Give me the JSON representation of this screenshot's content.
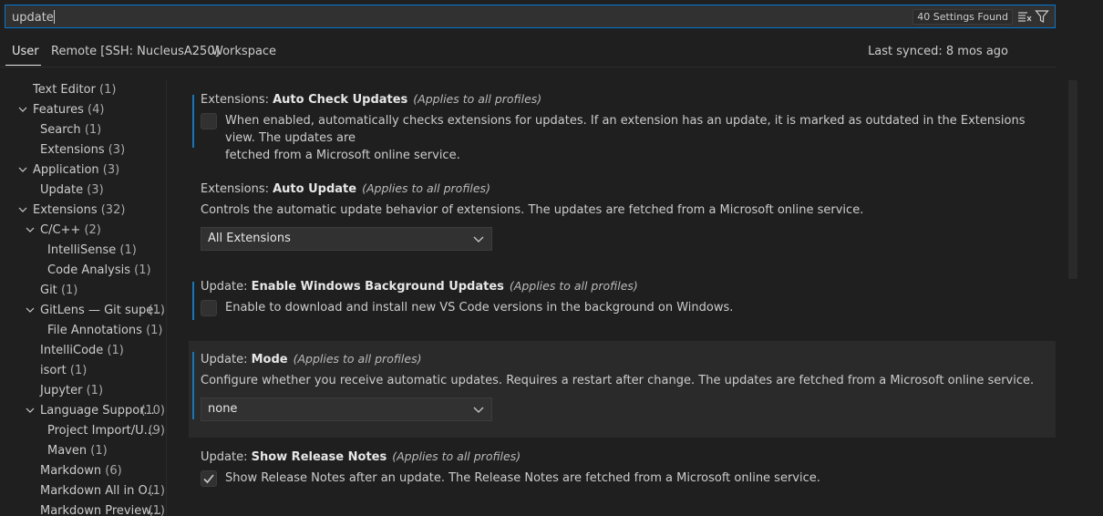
{
  "search": {
    "value": "update",
    "found_label": "40 Settings Found"
  },
  "tabs": [
    {
      "label": "User"
    },
    {
      "label": "Remote [SSH: NucleusA250]"
    },
    {
      "label": "Workspace"
    }
  ],
  "last_synced": "Last synced: 8 mos ago",
  "toc": {
    "items": [
      {
        "label": "Text Editor",
        "count": "(1)"
      },
      {
        "label": "Features",
        "count": "(4)"
      },
      {
        "label": "Search",
        "count": "(1)"
      },
      {
        "label": "Extensions",
        "count": "(3)"
      },
      {
        "label": "Application",
        "count": "(3)"
      },
      {
        "label": "Update",
        "count": "(3)"
      },
      {
        "label": "Extensions",
        "count": "(32)"
      },
      {
        "label": "C/C++",
        "count": "(2)"
      },
      {
        "label": "IntelliSense",
        "count": "(1)"
      },
      {
        "label": "Code Analysis",
        "count": "(1)"
      },
      {
        "label": "Git",
        "count": "(1)"
      },
      {
        "label": "GitLens — Git supe...",
        "count": "(1)"
      },
      {
        "label": "File Annotations",
        "count": "(1)"
      },
      {
        "label": "IntelliCode",
        "count": "(1)"
      },
      {
        "label": "isort",
        "count": "(1)"
      },
      {
        "label": "Jupyter",
        "count": "(1)"
      },
      {
        "label": "Language Suppor...",
        "count": "(10)"
      },
      {
        "label": "Project Import/U...",
        "count": "(9)"
      },
      {
        "label": "Maven",
        "count": "(1)"
      },
      {
        "label": "Markdown",
        "count": "(6)"
      },
      {
        "label": "Markdown All in O...",
        "count": "(1)"
      },
      {
        "label": "Markdown Preview...",
        "count": "(1)"
      }
    ]
  },
  "settings": {
    "auto_check": {
      "category": "Extensions: ",
      "name": "Auto Check Updates",
      "scope": "(Applies to all profiles)",
      "desc_line1": "When enabled, automatically checks extensions for updates. If an extension has an update, it is marked as outdated in the Extensions view. The updates are",
      "desc_line2": "fetched from a Microsoft online service.",
      "checked": false
    },
    "auto_update": {
      "category": "Extensions: ",
      "name": "Auto Update",
      "scope": "(Applies to all profiles)",
      "desc": "Controls the automatic update behavior of extensions. The updates are fetched from a Microsoft online service.",
      "value": "All Extensions"
    },
    "windows_bg": {
      "category": "Update: ",
      "name": "Enable Windows Background Updates",
      "scope": "(Applies to all profiles)",
      "desc": "Enable to download and install new VS Code versions in the background on Windows.",
      "checked": false
    },
    "mode": {
      "category": "Update: ",
      "name": "Mode",
      "scope": "(Applies to all profiles)",
      "desc": "Configure whether you receive automatic updates. Requires a restart after change. The updates are fetched from a Microsoft online service.",
      "value": "none"
    },
    "release_notes": {
      "category": "Update: ",
      "name": "Show Release Notes",
      "scope": "(Applies to all profiles)",
      "desc": "Show Release Notes after an update. The Release Notes are fetched from a Microsoft online service.",
      "checked": true
    }
  },
  "colors": {
    "accent": "#0078d4",
    "modified_bar": "#0c7ac4",
    "background": "#1f1f1f"
  }
}
